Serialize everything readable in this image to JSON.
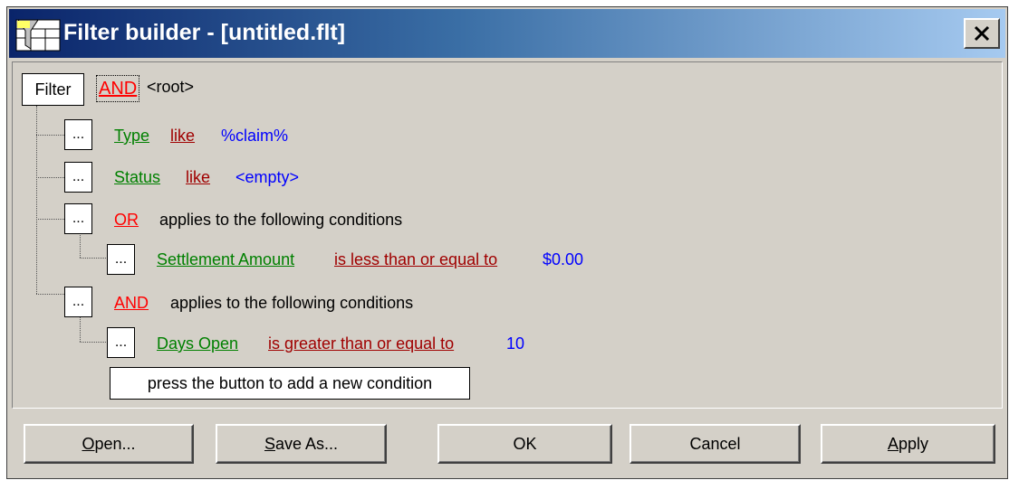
{
  "window": {
    "title": "Filter builder - [untitled.flt]"
  },
  "tree": {
    "filter_label": "Filter",
    "root_operator": "AND",
    "root_label": "<root>",
    "ellipsis": "...",
    "conditions": [
      {
        "field": "Type",
        "operator": "like",
        "value": "%claim%"
      },
      {
        "field": "Status",
        "operator": "like",
        "value": "<empty>"
      }
    ],
    "groups": [
      {
        "operator": "OR",
        "text": "applies to the following conditions",
        "condition": {
          "field": "Settlement Amount",
          "operator": "is less than or equal to",
          "value": "$0.00"
        }
      },
      {
        "operator": "AND",
        "text": "applies to the following conditions",
        "condition": {
          "field": "Days Open",
          "operator": "is greater than or equal to",
          "value": "10"
        }
      }
    ],
    "add_hint": "press the button to add a new condition"
  },
  "buttons": {
    "open": {
      "mnemonic": "O",
      "rest": "pen..."
    },
    "save_as": {
      "mnemonic": "S",
      "rest": "ave As..."
    },
    "ok": "OK",
    "cancel": "Cancel",
    "apply": {
      "mnemonic": "A",
      "rest": "pply"
    }
  }
}
